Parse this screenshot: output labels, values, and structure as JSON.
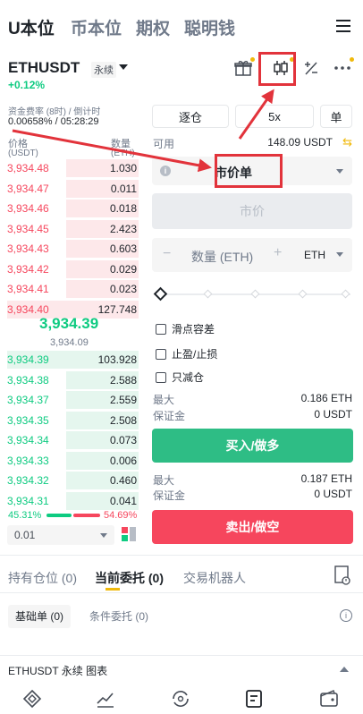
{
  "top_nav": {
    "tabs": [
      "U本位",
      "币本位",
      "期权",
      "聪明钱"
    ],
    "active_index": 0,
    "menu_icon": "hamburger-menu-icon"
  },
  "header": {
    "symbol": "ETHUSDT",
    "contract_type": "永续",
    "change": "+0.12%",
    "icons": [
      "gift-icon",
      "candlestick-chart-icon",
      "calculator-icon",
      "more-icon"
    ]
  },
  "funding": {
    "label": "资金费率 (8时) / 倒计时",
    "value": "0.00658% / 05:28:29"
  },
  "orderbook": {
    "price_label": "价格",
    "price_unit": "(USDT)",
    "qty_label": "数量",
    "qty_unit": "(ETH)",
    "asks": [
      {
        "price": "3,934.48",
        "qty": "1.030",
        "depth": 0.55
      },
      {
        "price": "3,934.47",
        "qty": "0.011",
        "depth": 0.55
      },
      {
        "price": "3,934.46",
        "qty": "0.018",
        "depth": 0.55
      },
      {
        "price": "3,934.45",
        "qty": "2.423",
        "depth": 0.55
      },
      {
        "price": "3,934.43",
        "qty": "0.603",
        "depth": 0.55
      },
      {
        "price": "3,934.42",
        "qty": "0.029",
        "depth": 0.55
      },
      {
        "price": "3,934.41",
        "qty": "0.023",
        "depth": 0.55
      },
      {
        "price": "3,934.40",
        "qty": "127.748",
        "depth": 1.0
      }
    ],
    "mid_price": "3,934.39",
    "mark_price": "3,934.09",
    "bids": [
      {
        "price": "3,934.39",
        "qty": "103.928",
        "depth": 1.0
      },
      {
        "price": "3,934.38",
        "qty": "2.588",
        "depth": 0.55
      },
      {
        "price": "3,934.37",
        "qty": "2.559",
        "depth": 0.55
      },
      {
        "price": "3,934.35",
        "qty": "2.508",
        "depth": 0.55
      },
      {
        "price": "3,934.34",
        "qty": "0.073",
        "depth": 0.55
      },
      {
        "price": "3,934.33",
        "qty": "0.006",
        "depth": 0.55
      },
      {
        "price": "3,934.32",
        "qty": "0.460",
        "depth": 0.55
      },
      {
        "price": "3,934.31",
        "qty": "0.041",
        "depth": 0.55
      }
    ],
    "buy_ratio": "45.31%",
    "sell_ratio": "54.69%",
    "precision": "0.01"
  },
  "trade": {
    "margin_mode": "逐仓",
    "leverage": "5x",
    "position_mode": "单",
    "available_label": "可用",
    "available_value": "148.09 USDT",
    "order_type": "市价单",
    "price_placeholder": "市价",
    "qty_placeholder": "数量 (ETH)",
    "qty_unit": "ETH",
    "options": [
      "滑点容差",
      "止盈/止损",
      "只减仓"
    ],
    "buy": {
      "max_label": "最大",
      "max_value": "0.186 ETH",
      "margin_label": "保证金",
      "margin_value": "0 USDT",
      "button": "买入/做多"
    },
    "sell": {
      "max_label": "最大",
      "max_value": "0.187 ETH",
      "margin_label": "保证金",
      "margin_value": "0 USDT",
      "button": "卖出/做空"
    }
  },
  "orders": {
    "tabs": [
      "持有仓位 (0)",
      "当前委托 (0)",
      "交易机器人"
    ],
    "active_index": 1,
    "subtabs": [
      "基础单 (0)",
      "条件委托 (0)"
    ],
    "active_subtab": 0
  },
  "chart_bar": {
    "label": "ETHUSDT 永续  图表"
  },
  "bottom_nav": [
    "home-icon",
    "markets-icon",
    "trade-icon",
    "futures-icon",
    "wallet-icon"
  ],
  "colors": {
    "buy": "#2ebd85",
    "sell": "#f6465d",
    "accent": "#f0b90b",
    "annotation": "#e2333b"
  }
}
